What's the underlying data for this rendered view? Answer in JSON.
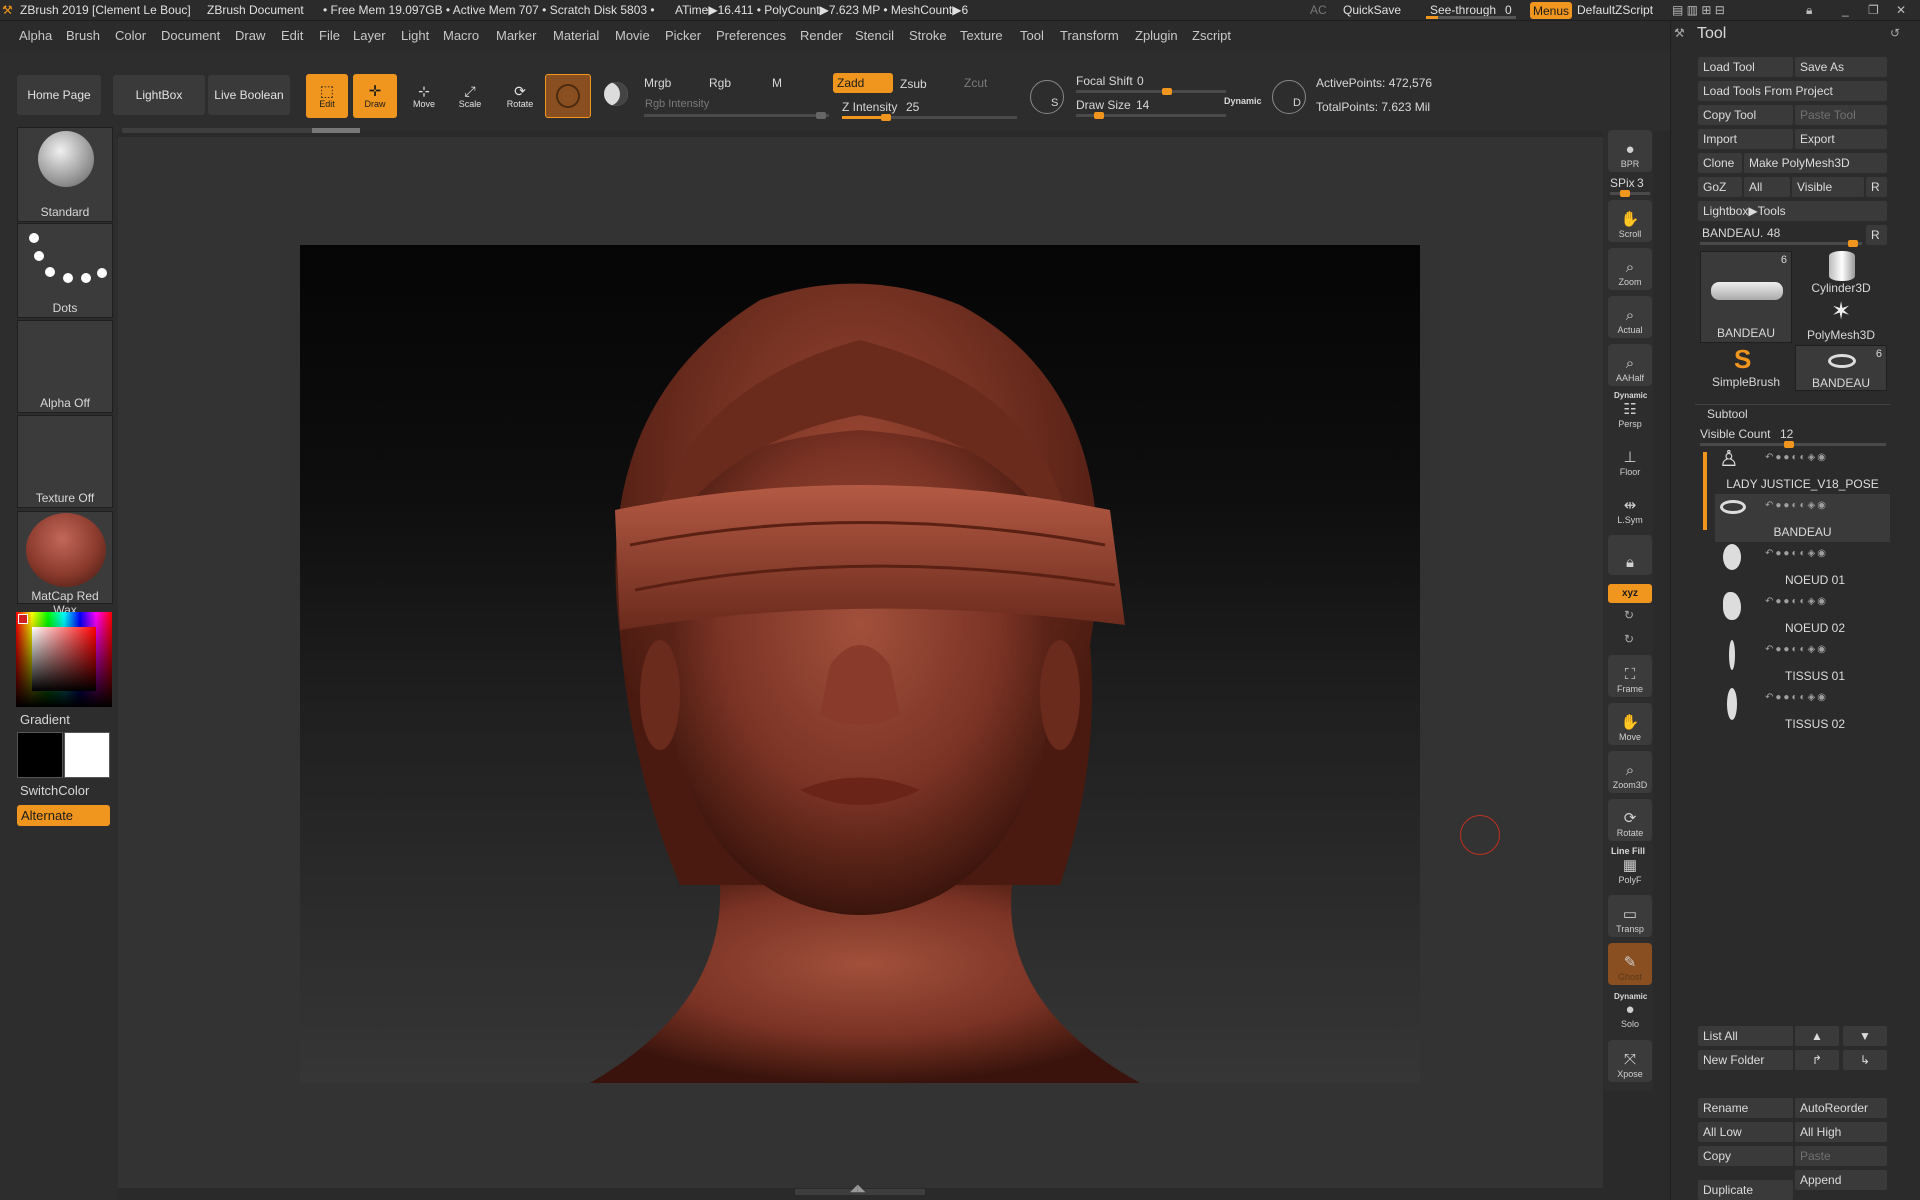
{
  "titlebar": {
    "app_title": "ZBrush 2019 [Clement Le Bouc]",
    "document": "ZBrush Document",
    "stats": "• Free Mem 19.097GB • Active Mem 707 • Scratch Disk 5803 •",
    "atime": "ATime▶16.411 • PolyCount▶7.623 MP • MeshCount▶6",
    "ac": "AC",
    "quicksave": "QuickSave",
    "see_through_label": "See-through",
    "see_through_value": "0",
    "menus": "Menus",
    "zscript": "DefaultZScript"
  },
  "menubar": {
    "items": [
      "Alpha",
      "Brush",
      "Color",
      "Document",
      "Draw",
      "Edit",
      "File",
      "Layer",
      "Light",
      "Macro",
      "Marker",
      "Material",
      "Movie",
      "Picker",
      "Preferences",
      "Render",
      "Stencil",
      "Stroke",
      "Texture",
      "Tool",
      "Transform",
      "Zplugin",
      "Zscript"
    ]
  },
  "toolbar": {
    "home_page": "Home Page",
    "lightbox": "LightBox",
    "live_boolean": "Live Boolean",
    "edit": "Edit",
    "draw": "Draw",
    "move": "Move",
    "scale": "Scale",
    "rotate": "Rotate",
    "mrgb": "Mrgb",
    "rgb": "Rgb",
    "m": "M",
    "rgb_intensity": "Rgb Intensity",
    "zadd": "Zadd",
    "zsub": "Zsub",
    "zcut": "Zcut",
    "z_intensity_label": "Z Intensity",
    "z_intensity_value": "25",
    "z_intensity_fraction": 0.25,
    "focal_shift_label": "Focal Shift",
    "focal_shift_value": "0",
    "draw_size_label": "Draw Size",
    "draw_size_value": "14",
    "dynamic": "Dynamic",
    "active_points": "ActivePoints: 472,576",
    "total_points": "TotalPoints: 7.623 Mil",
    "s_icon_letter": "S",
    "d_icon_letter": "D"
  },
  "left_shelf": {
    "brush": "Standard",
    "stroke": "Dots",
    "alpha": "Alpha Off",
    "texture": "Texture Off",
    "material": "MatCap Red Wax",
    "gradient": "Gradient",
    "switch_color": "SwitchColor",
    "alternate": "Alternate"
  },
  "right_shelf": {
    "bpr": "BPR",
    "spix_label": "SPix",
    "spix_value": "3",
    "buttons": [
      "Scroll",
      "Zoom",
      "Actual",
      "AAHalf",
      "Persp",
      "Floor",
      "L.Sym",
      "Frame",
      "Move",
      "Zoom3D",
      "Rotate",
      "PolyF",
      "Transp",
      "Ghost",
      "Solo",
      "Xpose"
    ],
    "persp_top": "Dynamic",
    "polyf_top": "Line Fill",
    "solo_top": "Dynamic",
    "xyz": "xyz"
  },
  "tool_panel": {
    "title": "Tool",
    "load_tool": "Load Tool",
    "save_as": "Save As",
    "load_from_project": "Load Tools From Project",
    "copy_tool": "Copy Tool",
    "paste_tool": "Paste Tool",
    "import": "Import",
    "export": "Export",
    "clone": "Clone",
    "make_polymesh": "Make PolyMesh3D",
    "goz": "GoZ",
    "all": "All",
    "visible": "Visible",
    "r": "R",
    "lightbox_tools": "Lightbox▶Tools",
    "current_tool_label": "BANDEAU.",
    "current_tool_value": "48",
    "thumbs": [
      {
        "name": "BANDEAU",
        "badge": "6"
      },
      {
        "name": "Cylinder3D",
        "badge": ""
      },
      {
        "name": "PolyMesh3D",
        "badge": ""
      },
      {
        "name": "SimpleBrush",
        "badge": ""
      },
      {
        "name": "BANDEAU",
        "badge": "6"
      }
    ],
    "subtool_header": "Subtool",
    "visible_count_label": "Visible Count",
    "visible_count_value": "12",
    "subtools": [
      "LADY JUSTICE_V18_POSE",
      "BANDEAU",
      "NOEUD 01",
      "NOEUD 02",
      "TISSUS 01",
      "TISSUS 02"
    ],
    "list_all": "List All",
    "new_folder": "New Folder",
    "rename": "Rename",
    "auto_reorder": "AutoReorder",
    "all_low": "All Low",
    "all_high": "All High",
    "copy": "Copy",
    "paste": "Paste",
    "duplicate": "Duplicate",
    "append": "Append"
  },
  "colors": {
    "accent": "#f0961e",
    "clay": "#8a3a2c"
  }
}
